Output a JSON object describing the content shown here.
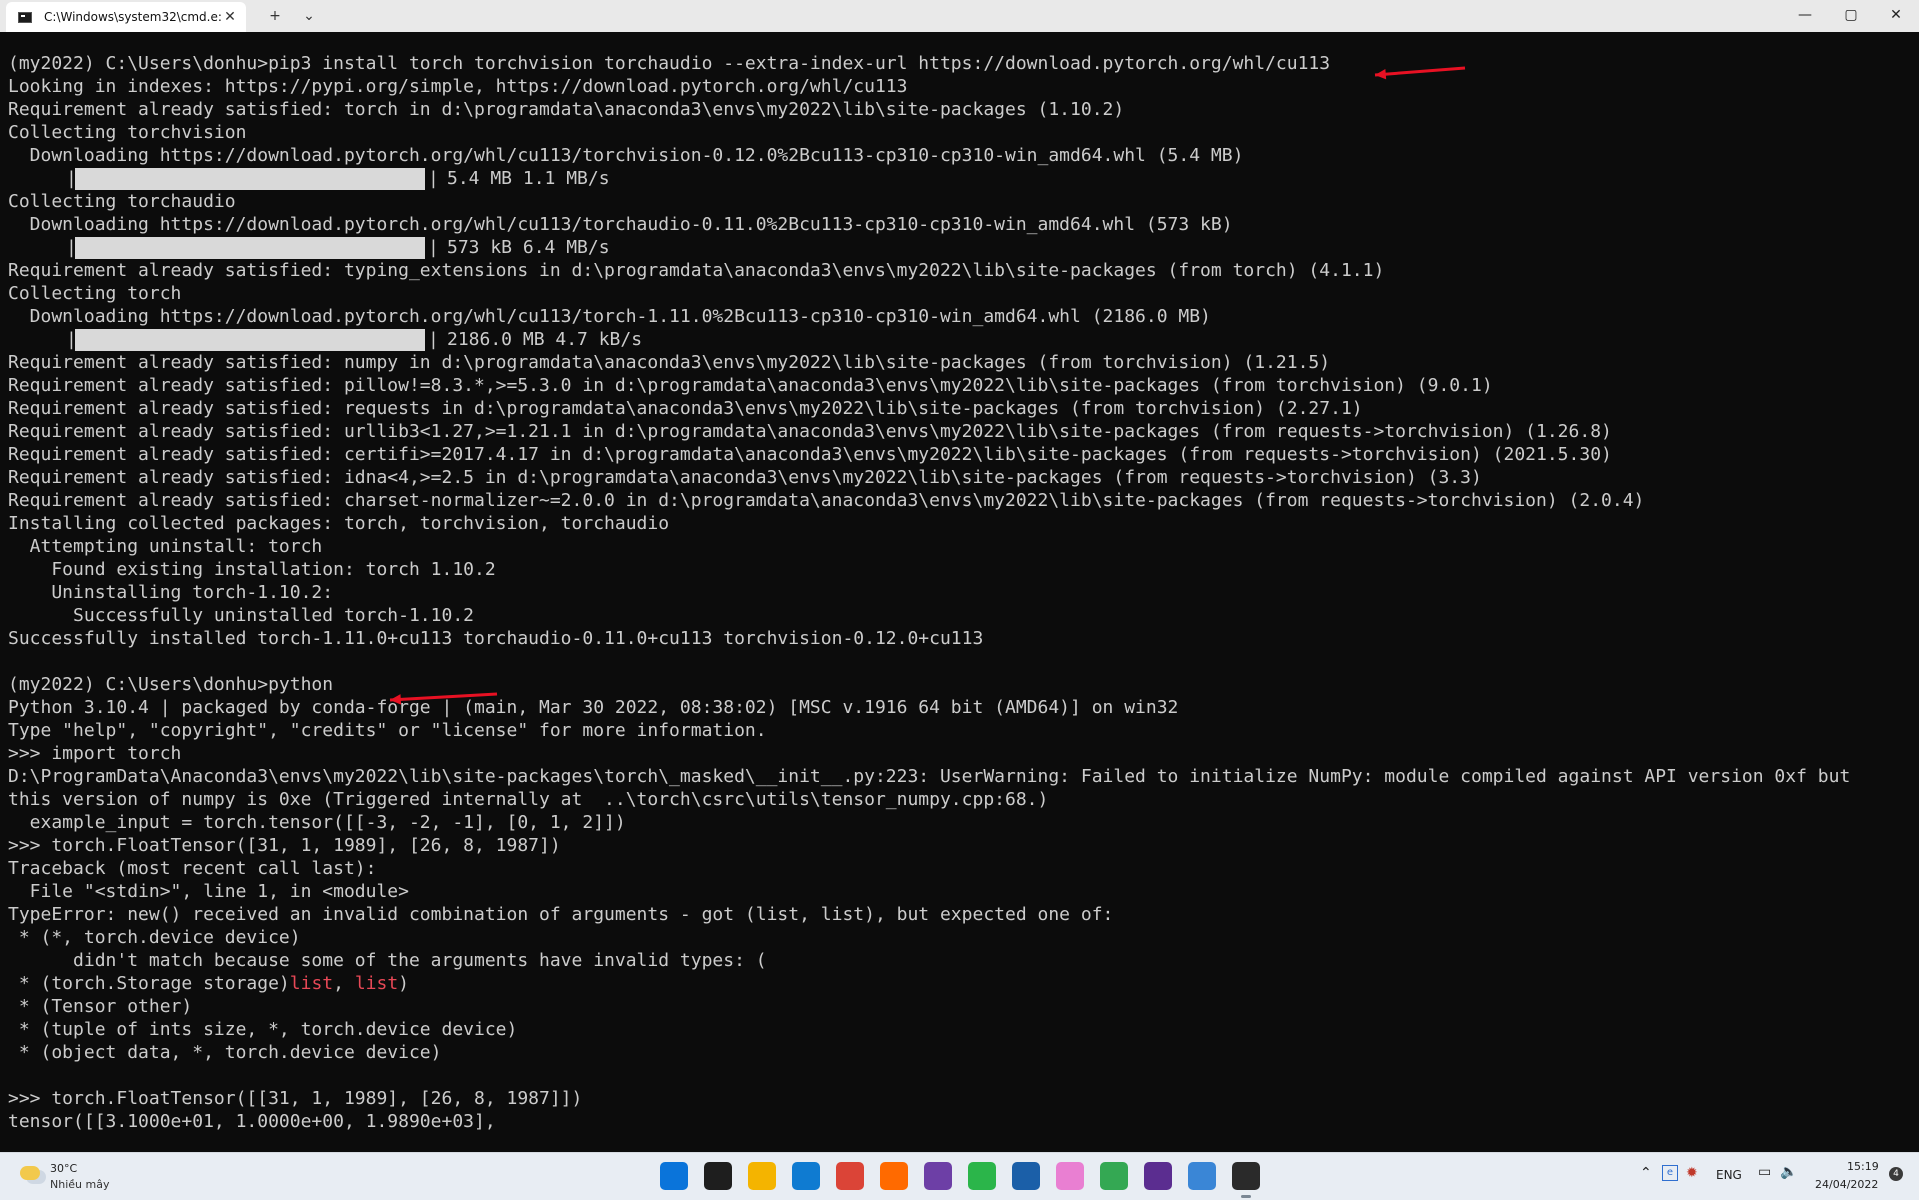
{
  "titlebar": {
    "tab_title": "C:\\Windows\\system32\\cmd.e:",
    "tab_close": "✕",
    "new_tab": "+",
    "dropdown": "⌄",
    "minimize": "—",
    "maximize": "▢",
    "close": "✕"
  },
  "console": {
    "lines": [
      "(my2022) C:\\Users\\donhu>pip3 install torch torchvision torchaudio --extra-index-url https://download.pytorch.org/whl/cu113",
      "Looking in indexes: https://pypi.org/simple, https://download.pytorch.org/whl/cu113",
      "Requirement already satisfied: torch in d:\\programdata\\anaconda3\\envs\\my2022\\lib\\site-packages (1.10.2)",
      "Collecting torchvision",
      "  Downloading https://download.pytorch.org/whl/cu113/torchvision-0.12.0%2Bcu113-cp310-cp310-win_amd64.whl (5.4 MB)",
      "5.4 MB 1.1 MB/s",
      "Collecting torchaudio",
      "  Downloading https://download.pytorch.org/whl/cu113/torchaudio-0.11.0%2Bcu113-cp310-cp310-win_amd64.whl (573 kB)",
      "573 kB 6.4 MB/s",
      "Requirement already satisfied: typing_extensions in d:\\programdata\\anaconda3\\envs\\my2022\\lib\\site-packages (from torch) (4.1.1)",
      "Collecting torch",
      "  Downloading https://download.pytorch.org/whl/cu113/torch-1.11.0%2Bcu113-cp310-cp310-win_amd64.whl (2186.0 MB)",
      "2186.0 MB 4.7 kB/s",
      "Requirement already satisfied: numpy in d:\\programdata\\anaconda3\\envs\\my2022\\lib\\site-packages (from torchvision) (1.21.5)",
      "Requirement already satisfied: pillow!=8.3.*,>=5.3.0 in d:\\programdata\\anaconda3\\envs\\my2022\\lib\\site-packages (from torchvision) (9.0.1)",
      "Requirement already satisfied: requests in d:\\programdata\\anaconda3\\envs\\my2022\\lib\\site-packages (from torchvision) (2.27.1)",
      "Requirement already satisfied: urllib3<1.27,>=1.21.1 in d:\\programdata\\anaconda3\\envs\\my2022\\lib\\site-packages (from requests->torchvision) (1.26.8)",
      "Requirement already satisfied: certifi>=2017.4.17 in d:\\programdata\\anaconda3\\envs\\my2022\\lib\\site-packages (from requests->torchvision) (2021.5.30)",
      "Requirement already satisfied: idna<4,>=2.5 in d:\\programdata\\anaconda3\\envs\\my2022\\lib\\site-packages (from requests->torchvision) (3.3)",
      "Requirement already satisfied: charset-normalizer~=2.0.0 in d:\\programdata\\anaconda3\\envs\\my2022\\lib\\site-packages (from requests->torchvision) (2.0.4)",
      "Installing collected packages: torch, torchvision, torchaudio",
      "  Attempting uninstall: torch",
      "    Found existing installation: torch 1.10.2",
      "    Uninstalling torch-1.10.2:",
      "      Successfully uninstalled torch-1.10.2",
      "Successfully installed torch-1.11.0+cu113 torchaudio-0.11.0+cu113 torchvision-0.12.0+cu113",
      "",
      "(my2022) C:\\Users\\donhu>python",
      "Python 3.10.4 | packaged by conda-forge | (main, Mar 30 2022, 08:38:02) [MSC v.1916 64 bit (AMD64)] on win32",
      "Type \"help\", \"copyright\", \"credits\" or \"license\" for more information.",
      ">>> import torch",
      "D:\\ProgramData\\Anaconda3\\envs\\my2022\\lib\\site-packages\\torch\\_masked\\__init__.py:223: UserWarning: Failed to initialize NumPy: module compiled against API version 0xf but",
      "this version of numpy is 0xe (Triggered internally at  ..\\torch\\csrc\\utils\\tensor_numpy.cpp:68.)",
      "  example_input = torch.tensor([[-3, -2, -1], [0, 1, 2]])",
      ">>> torch.FloatTensor([31, 1, 1989], [26, 8, 1987])",
      "Traceback (most recent call last):",
      "  File \"<stdin>\", line 1, in <module>",
      "TypeError: new() received an invalid combination of arguments - got (list, list), but expected one of:",
      " * (*, torch.device device)",
      "      didn't match because some of the arguments have invalid types: (",
      " * (torch.Storage storage)",
      " * (Tensor other)",
      " * (tuple of ints size, *, torch.device device)",
      " * (object data, *, torch.device device)",
      "",
      ">>> torch.FloatTensor([[31, 1, 1989], [26, 8, 1987]])",
      "tensor([[3.1000e+01, 1.0000e+00, 1.9890e+03],"
    ],
    "err_list_1": "list",
    "err_sep": ", ",
    "err_list_2": "list",
    "err_close": ")",
    "progress": [
      {
        "fraction": 1.0
      },
      {
        "fraction": 1.0
      },
      {
        "fraction": 1.0
      }
    ]
  },
  "annotation_color": "#e81123",
  "taskbar": {
    "weather_temp": "30°C",
    "weather_cond": "Nhiều mây",
    "lang": "ENG",
    "time": "15:19",
    "date": "24/04/2022",
    "notif_count": "4",
    "apps": [
      {
        "icon": "windows-start-icon",
        "color": "#0a74da"
      },
      {
        "icon": "task-view-icon",
        "color": "#1e1e1e"
      },
      {
        "icon": "file-explorer-icon",
        "color": "#f4b400"
      },
      {
        "icon": "edge-icon",
        "color": "#0f7bd1"
      },
      {
        "icon": "chrome-icon",
        "color": "#db4437"
      },
      {
        "icon": "sublime-text-icon",
        "color": "#ff6a00"
      },
      {
        "icon": "visual-studio-icon",
        "color": "#6d3fa6"
      },
      {
        "icon": "sync-app-icon",
        "color": "#2bb54a"
      },
      {
        "icon": "remote-desktop-icon",
        "color": "#1b5fa8"
      },
      {
        "icon": "pinwheel-app-icon",
        "color": "#e97fd2"
      },
      {
        "icon": "chrome-profile-icon",
        "color": "#34a853"
      },
      {
        "icon": "media-player-icon",
        "color": "#5b2d90"
      },
      {
        "icon": "notepad-icon",
        "color": "#3a86d6"
      },
      {
        "icon": "terminal-icon",
        "color": "#2a2a2a"
      }
    ]
  }
}
